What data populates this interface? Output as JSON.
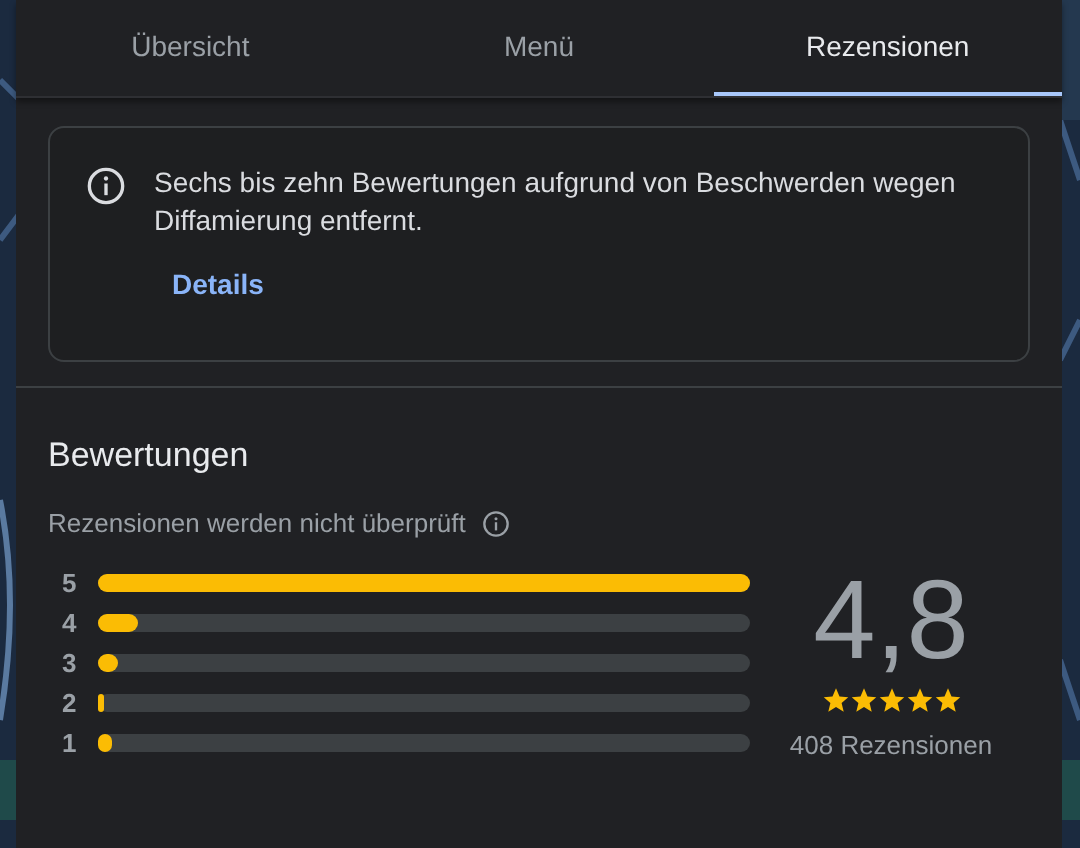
{
  "tabs": [
    {
      "label": "Übersicht",
      "selected": false
    },
    {
      "label": "Menü",
      "selected": false
    },
    {
      "label": "Rezensionen",
      "selected": true
    }
  ],
  "notice": {
    "text": "Sechs bis zehn Bewertungen aufgrund von Beschwerden wegen Diffamierung entfernt.",
    "link": "Details"
  },
  "ratings": {
    "title": "Bewertungen",
    "subtitle": "Rezensionen werden nicht überprüft",
    "bars": [
      {
        "label": "5",
        "level": 1.0
      },
      {
        "label": "4",
        "level": 0.06
      },
      {
        "label": "3",
        "level": 0.03
      },
      {
        "label": "2",
        "level": 0.01
      },
      {
        "label": "1",
        "level": 0.02
      }
    ],
    "score": "4,8",
    "stars": 5,
    "count": "408 Rezensionen"
  }
}
